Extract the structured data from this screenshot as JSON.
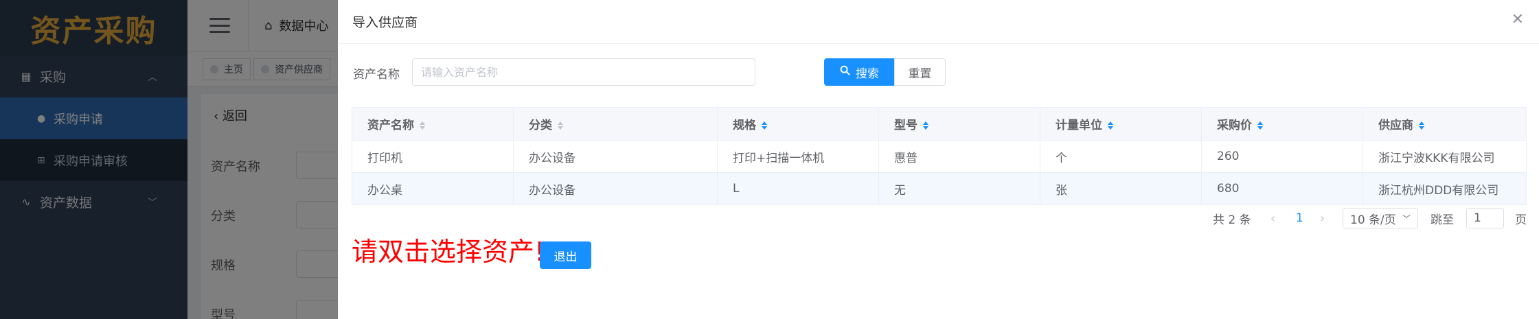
{
  "app": {
    "logo_text": "资产采购"
  },
  "sidebar": {
    "groups": [
      {
        "label": "采购",
        "icon": "grid-icon",
        "expanded": true
      },
      {
        "label": "资产数据",
        "icon": "pulse-icon",
        "expanded": false
      }
    ],
    "items": [
      {
        "label": "采购申请",
        "active": true
      },
      {
        "label": "采购申请审核",
        "active": false
      }
    ]
  },
  "topbar": {
    "tab_label": "数据中心"
  },
  "tags": {
    "home": "主页",
    "supplier": "资产供应商"
  },
  "content": {
    "back_label": "返回",
    "form_labels": [
      "资产名称",
      "分类",
      "规格",
      "型号"
    ]
  },
  "dialog": {
    "title": "导入供应商",
    "search": {
      "label": "资产名称",
      "placeholder": "请输入资产名称",
      "value": "",
      "search_button": "搜索",
      "reset_button": "重置"
    },
    "table": {
      "columns": [
        "资产名称",
        "分类",
        "规格",
        "型号",
        "计量单位",
        "采购价",
        "供应商"
      ],
      "rows": [
        [
          "打印机",
          "办公设备",
          "打印+扫描一体机",
          "惠普",
          "个",
          "260",
          "浙江宁波KKK有限公司"
        ],
        [
          "办公桌",
          "办公设备",
          "L",
          "无",
          "张",
          "680",
          "浙江杭州DDD有限公司"
        ]
      ]
    },
    "pagination": {
      "total": "共 2 条",
      "current_page": "1",
      "page_size": "10 条/页",
      "jump_label": "跳至",
      "jump_value": "1",
      "page_suffix": "页"
    },
    "hint_text": "请双击选择资产!",
    "exit_button": "退出"
  },
  "colors": {
    "primary": "#1890ff",
    "hint": "#ff0000",
    "sidebar": "#304156",
    "logo": "#e8ab3a"
  }
}
